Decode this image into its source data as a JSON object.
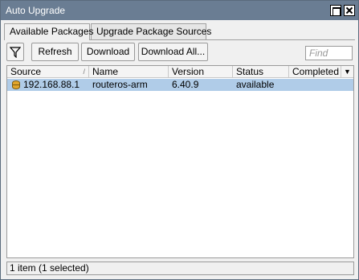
{
  "window": {
    "title": "Auto Upgrade"
  },
  "tabs": [
    {
      "label": "Available Packages",
      "active": true
    },
    {
      "label": "Upgrade Package Sources",
      "active": false
    }
  ],
  "toolbar": {
    "filter_icon": "funnel-icon",
    "refresh_label": "Refresh",
    "download_label": "Download",
    "download_all_label": "Download All...",
    "find_placeholder": "Find"
  },
  "table": {
    "columns": [
      "Source",
      "Name",
      "Version",
      "Status",
      "Completed"
    ],
    "sorted_column": "Source",
    "rows": [
      {
        "source": "192.168.88.1",
        "name": "routeros-arm",
        "version": "6.40.9",
        "status": "available",
        "completed": "",
        "selected": true
      }
    ]
  },
  "statusbar": {
    "text": "1 item (1 selected)"
  },
  "colors": {
    "titlebar": "#6a7d93",
    "selection": "#b0cce8"
  }
}
